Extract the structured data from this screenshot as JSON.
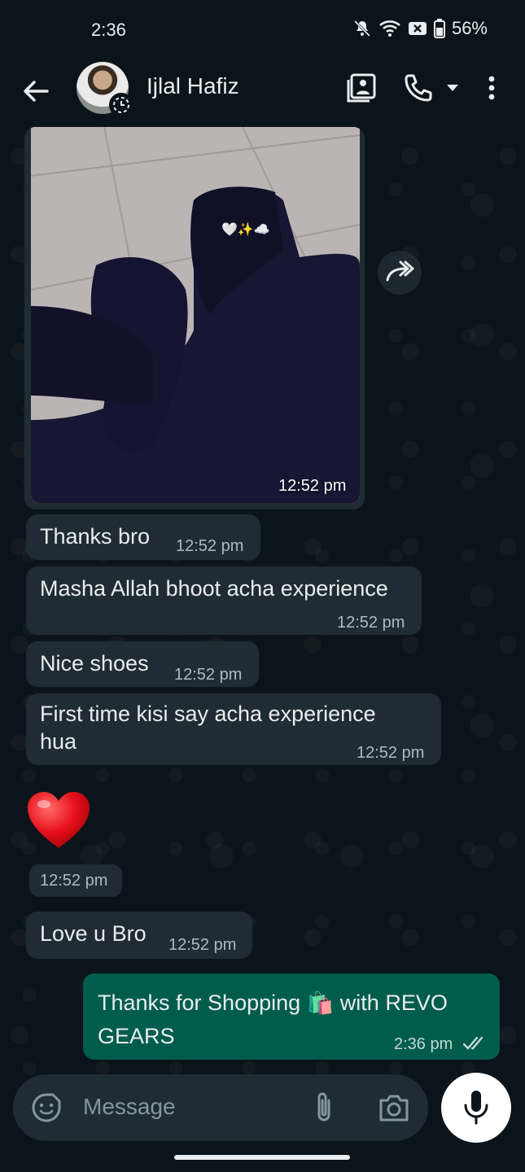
{
  "status_bar": {
    "time": "2:36",
    "battery": "56%",
    "icons": [
      "mute-icon",
      "wifi-icon",
      "data-off-icon",
      "battery-icon"
    ]
  },
  "header": {
    "contact_name": "Ijlal Hafiz",
    "icons": [
      "back-arrow-icon",
      "video-gallery-icon",
      "phone-icon",
      "dropdown-icon",
      "more-icon"
    ]
  },
  "photo_message": {
    "time": "12:52 pm",
    "sticker": "🤍✨☁️"
  },
  "messages": [
    {
      "id": "m1",
      "text": "Thanks bro",
      "time": "12:52 pm",
      "direction": "in"
    },
    {
      "id": "m2",
      "text": "Masha Allah bhoot acha experience",
      "time": "12:52 pm",
      "direction": "in"
    },
    {
      "id": "m3",
      "text": "Nice shoes",
      "time": "12:52 pm",
      "direction": "in"
    },
    {
      "id": "m4",
      "text": "First time kisi say acha experience hua",
      "time": "12:52 pm",
      "direction": "in"
    },
    {
      "id": "m5",
      "text": "❤️",
      "time": "12:52 pm",
      "direction": "in"
    },
    {
      "id": "m6",
      "text": "Love u Bro",
      "time": "12:52 pm",
      "direction": "in"
    },
    {
      "id": "m7",
      "text_before": "Thanks for Shopping ",
      "emoji": "🛍️",
      "text_after": " with REVO GEARS",
      "time": "2:36 pm",
      "direction": "out",
      "status": "read"
    }
  ],
  "input": {
    "placeholder": "Message",
    "icons": [
      "sticker-icon",
      "attach-icon",
      "camera-icon",
      "mic-icon"
    ]
  },
  "colors": {
    "background": "#0b141a",
    "incoming": "#202c33",
    "outgoing": "#005c4b",
    "accent": "#00a884"
  }
}
